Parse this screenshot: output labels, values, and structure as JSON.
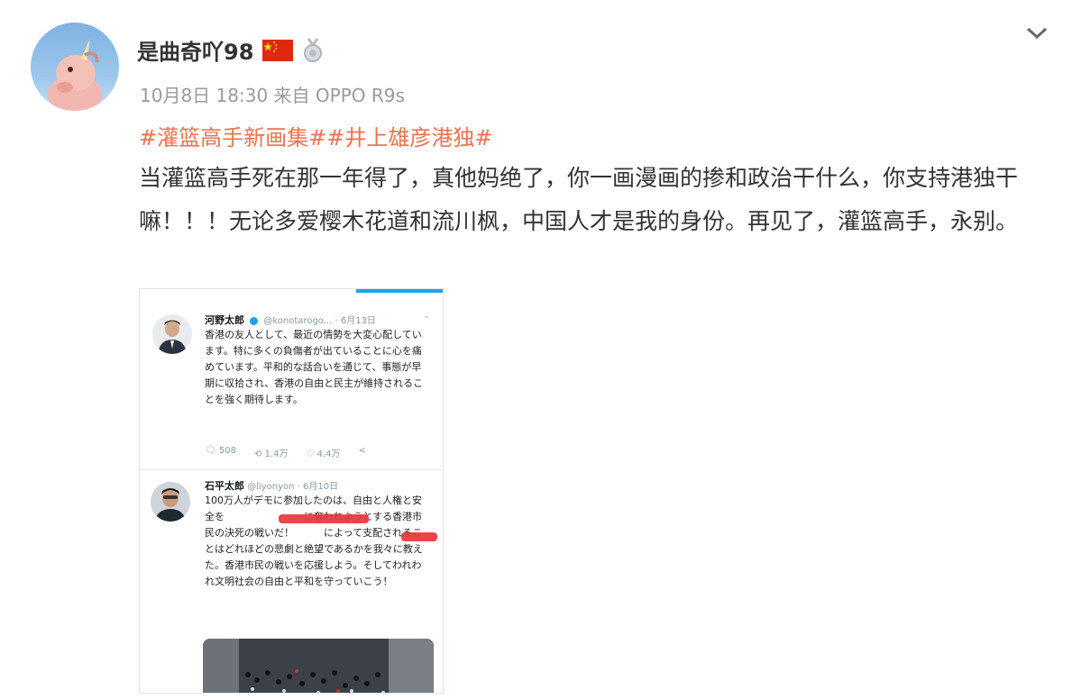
{
  "post": {
    "username": "是曲奇吖98",
    "chevron_icon": "chevron-down-icon",
    "meta": {
      "date": "10月8日 18:30",
      "source_prefix": "来自",
      "device": "OPPO R9s"
    },
    "tags": [
      "#灌篮高手新画集#",
      "#井上雄彦港独#"
    ],
    "text": "当灌篮高手死在那一年得了，真他妈绝了，你一画漫画的掺和政治干什么，你支持港独干嘛！！！无论多爱樱木花道和流川枫，中国人才是我的身份。再见了，灌篮高手，永别。"
  },
  "embedded_screenshot": {
    "tweet1": {
      "name": "河野太郎",
      "handle": "@konotarogo...",
      "date": "· 6月13日",
      "text": "香港の友人として、最近の情勢を大変心配しています。特に多くの負傷者が出ていることに心を痛めています。平和的な話合いを通じて、事態が早期に収拾され、香港の自由と民主が維持されることを強く期待します。",
      "replies": "508",
      "retweets": "1.4万",
      "likes": "4.4万"
    },
    "tweet2": {
      "name": "石平太郎",
      "handle": "@liyonyon",
      "date": "· 6月10日",
      "text": "100万人がデモに参加したのは、自由と人権と安全を　　　　　　　　に奪われようとする香港市民の決死の戦いだ！　　　によって支配されることはどれほどの悲劇と絶望であるかを我々に教えた。香港市民の戦いを応援しよう。そしてわれわれ文明社会の自由と平和を守っていこう！"
    }
  },
  "colors": {
    "link": "#eb7350",
    "meta": "#9a9a9a",
    "text": "#333333",
    "twitter_blue": "#1da1f2"
  }
}
